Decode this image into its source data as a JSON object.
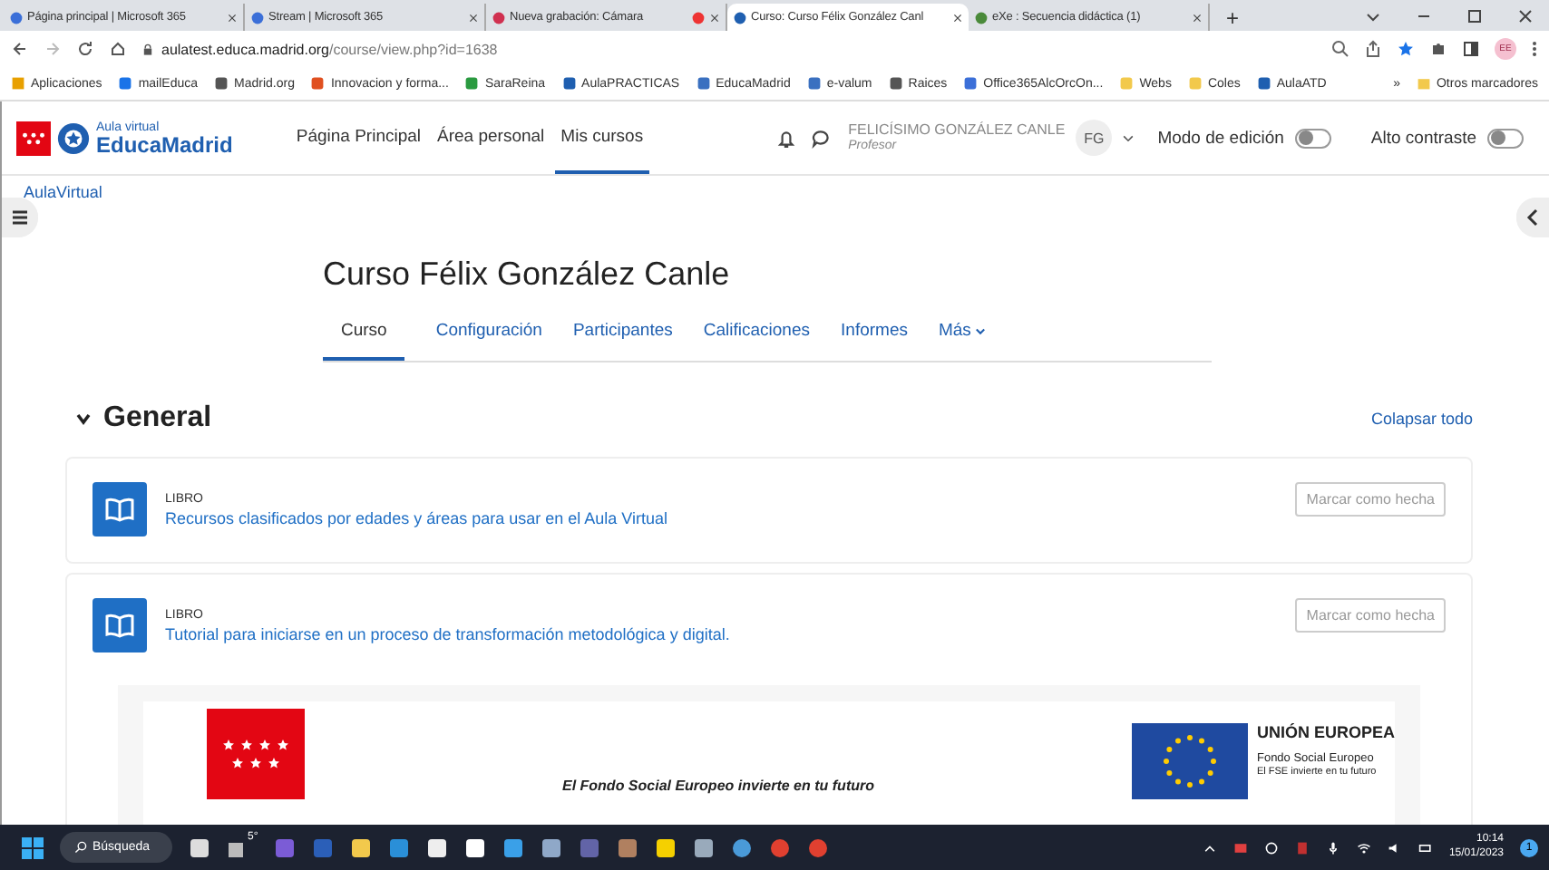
{
  "browser": {
    "tabs": [
      {
        "title": "Página principal | Microsoft 365",
        "selected": false,
        "recording": false
      },
      {
        "title": "Stream | Microsoft 365",
        "selected": false,
        "recording": false
      },
      {
        "title": "Nueva grabación: Cámara",
        "selected": false,
        "recording": true
      },
      {
        "title": "Curso: Curso Félix González Canl",
        "selected": true,
        "recording": false
      },
      {
        "title": "eXe : Secuencia didáctica (1)",
        "selected": false,
        "recording": false
      }
    ],
    "new_tab": "+",
    "url_host": "aulatest.educa.madrid.org",
    "url_path": "/course/view.php?id=1638",
    "profile": "EE",
    "bookmarks": [
      {
        "label": "Aplicaciones"
      },
      {
        "label": "mailEduca"
      },
      {
        "label": "Madrid.org"
      },
      {
        "label": "Innovacion y forma..."
      },
      {
        "label": "SaraReina"
      },
      {
        "label": "AulaPRACTICAS"
      },
      {
        "label": "EducaMadrid"
      },
      {
        "label": "e-valum"
      },
      {
        "label": "Raices"
      },
      {
        "label": "Office365AlcOrcOn..."
      },
      {
        "label": "Webs"
      },
      {
        "label": "Coles"
      },
      {
        "label": "AulaATD"
      }
    ],
    "bookmarks_more": "»",
    "other_bookmarks": "Otros marcadores"
  },
  "site": {
    "logo_small": "Aula virtual",
    "logo_big": "EducaMadrid",
    "nav": [
      {
        "label": "Página Principal",
        "selected": false
      },
      {
        "label": "Área personal",
        "selected": false
      },
      {
        "label": "Mis cursos",
        "selected": true
      }
    ],
    "user": {
      "name": "FELICÍSIMO GONZÁLEZ CANLE",
      "role": "Profesor",
      "initials": "FG"
    },
    "toggles": [
      {
        "label": "Modo de edición",
        "on": false
      },
      {
        "label": "Alto contraste",
        "on": false
      }
    ]
  },
  "breadcrumb": "AulaVirtual",
  "course": {
    "title": "Curso Félix González Canle",
    "tabs": [
      {
        "label": "Curso",
        "selected": true,
        "dropdown": false
      },
      {
        "label": "Configuración",
        "selected": false,
        "dropdown": false
      },
      {
        "label": "Participantes",
        "selected": false,
        "dropdown": false
      },
      {
        "label": "Calificaciones",
        "selected": false,
        "dropdown": false
      },
      {
        "label": "Informes",
        "selected": false,
        "dropdown": false
      },
      {
        "label": "Más",
        "selected": false,
        "dropdown": true
      }
    ]
  },
  "section": {
    "title": "General",
    "expanded": true,
    "collapse_all": "Colapsar todo"
  },
  "activities": [
    {
      "type": "LIBRO",
      "name": "Recursos clasificados por edades y áreas para usar en el Aula Virtual",
      "button": "Marcar como hecha"
    },
    {
      "type": "LIBRO",
      "name": "Tutorial para iniciarse en un proceso de transformación metodológica y digital.",
      "button": "Marcar como hecha"
    }
  ],
  "banner": {
    "motto": "El Fondo Social Europeo invierte en tu futuro",
    "eu_title": "UNIÓN EUROPEA",
    "eu_fund": "Fondo Social Europeo",
    "eu_motto": "El FSE invierte en tu futuro"
  },
  "taskbar": {
    "search": "Búsqueda",
    "weather": "5°",
    "time": "10:14",
    "date": "15/01/2023",
    "notifications": "1"
  }
}
